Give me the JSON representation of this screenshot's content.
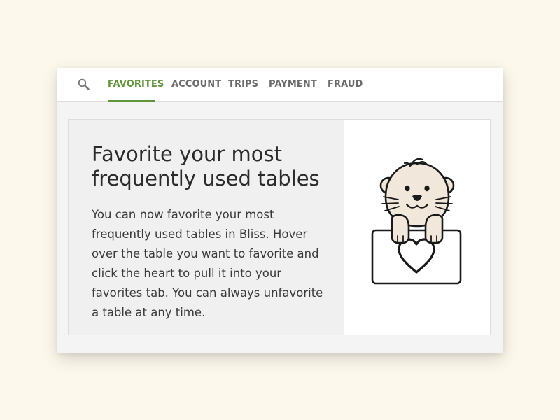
{
  "nav": {
    "search_icon": "search-icon",
    "tabs": [
      {
        "label": "FAVORITES",
        "active": true
      },
      {
        "label": "ACCOUNT",
        "active": false
      },
      {
        "label": "TRIPS",
        "active": false
      },
      {
        "label": "PAYMENT",
        "active": false
      },
      {
        "label": "FRAUD",
        "active": false
      }
    ]
  },
  "card": {
    "title": "Favorite your most frequently used tables",
    "body": "You can now favorite your most frequently used tables in Bliss. Hover over the table you want to favorite and click the heart to pull it into your favorites tab. You can always unfavorite a table at any time.",
    "illustration": "otter-holding-heart-sign-illustration"
  },
  "colors": {
    "page_background": "#fdf8ec",
    "accent": "#62953b",
    "tab_inactive": "#6b6b6b",
    "card_background": "#f0f0f0",
    "otter_fur": "#f1e7da"
  }
}
